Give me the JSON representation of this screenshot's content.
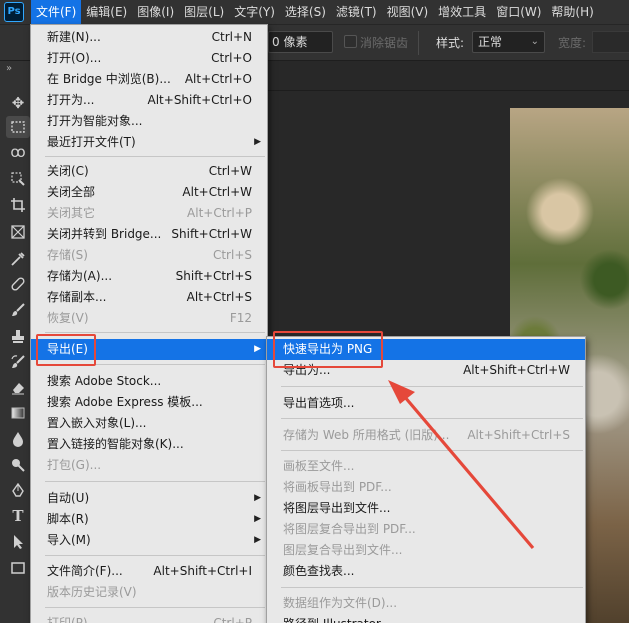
{
  "menubar": {
    "logo": "Ps",
    "items": [
      "文件(F)",
      "编辑(E)",
      "图像(I)",
      "图层(L)",
      "文字(Y)",
      "选择(S)",
      "滤镜(T)",
      "视图(V)",
      "增效工具",
      "窗口(W)",
      "帮助(H)"
    ]
  },
  "options": {
    "feather_value": "0 像素",
    "antialias_label": "消除锯齿",
    "style_label": "样式:",
    "style_value": "正常",
    "width_label": "宽度:"
  },
  "toolbar": {
    "collapse": "»",
    "tools": [
      "move-tool",
      "marquee-tool",
      "lasso-tool",
      "quick-select-tool",
      "crop-tool",
      "frame-tool",
      "eyedropper-tool",
      "healing-tool",
      "brush-tool",
      "stamp-tool",
      "history-brush-tool",
      "eraser-tool",
      "gradient-tool",
      "blur-tool",
      "dodge-tool",
      "pen-tool",
      "text-tool",
      "path-select-tool",
      "rectangle-tool"
    ]
  },
  "file_menu": {
    "items": [
      {
        "label": "新建(N)...",
        "shortcut": "Ctrl+N"
      },
      {
        "label": "打开(O)...",
        "shortcut": "Ctrl+O"
      },
      {
        "label": "在 Bridge 中浏览(B)...",
        "shortcut": "Alt+Ctrl+O"
      },
      {
        "label": "打开为...",
        "shortcut": "Alt+Shift+Ctrl+O"
      },
      {
        "label": "打开为智能对象...",
        "shortcut": ""
      },
      {
        "label": "最近打开文件(T)",
        "shortcut": "",
        "submenu": true
      },
      {
        "label": "关闭(C)",
        "shortcut": "Ctrl+W"
      },
      {
        "label": "关闭全部",
        "shortcut": "Alt+Ctrl+W"
      },
      {
        "label": "关闭其它",
        "shortcut": "Alt+Ctrl+P",
        "disabled": true
      },
      {
        "label": "关闭并转到 Bridge...",
        "shortcut": "Shift+Ctrl+W"
      },
      {
        "label": "存储(S)",
        "shortcut": "Ctrl+S",
        "disabled": true
      },
      {
        "label": "存储为(A)...",
        "shortcut": "Shift+Ctrl+S"
      },
      {
        "label": "存储副本...",
        "shortcut": "Alt+Ctrl+S"
      },
      {
        "label": "恢复(V)",
        "shortcut": "F12",
        "disabled": true
      },
      {
        "label": "导出(E)",
        "shortcut": "",
        "submenu": true,
        "highlighted": true
      },
      {
        "label": "搜索 Adobe Stock...",
        "shortcut": ""
      },
      {
        "label": "搜索 Adobe Express 模板...",
        "shortcut": ""
      },
      {
        "label": "置入嵌入对象(L)...",
        "shortcut": ""
      },
      {
        "label": "置入链接的智能对象(K)...",
        "shortcut": ""
      },
      {
        "label": "打包(G)...",
        "shortcut": "",
        "disabled": true
      },
      {
        "label": "自动(U)",
        "shortcut": "",
        "submenu": true
      },
      {
        "label": "脚本(R)",
        "shortcut": "",
        "submenu": true
      },
      {
        "label": "导入(M)",
        "shortcut": "",
        "submenu": true
      },
      {
        "label": "文件简介(F)...",
        "shortcut": "Alt+Shift+Ctrl+I"
      },
      {
        "label": "版本历史记录(V)",
        "shortcut": "",
        "disabled": true
      },
      {
        "label": "打印(P)...",
        "shortcut": "Ctrl+P",
        "disabled": true
      }
    ]
  },
  "export_menu": {
    "items": [
      {
        "label": "快速导出为 PNG",
        "shortcut": "",
        "highlighted": true
      },
      {
        "label": "导出为...",
        "shortcut": "Alt+Shift+Ctrl+W"
      },
      {
        "label": "导出首选项...",
        "shortcut": ""
      },
      {
        "label": "存储为 Web 所用格式 (旧版)...",
        "shortcut": "Alt+Shift+Ctrl+S",
        "disabled": true
      },
      {
        "label": "画板至文件...",
        "shortcut": "",
        "disabled": true
      },
      {
        "label": "将画板导出到 PDF...",
        "shortcut": "",
        "disabled": true
      },
      {
        "label": "将图层导出到文件...",
        "shortcut": ""
      },
      {
        "label": "将图层复合导出到 PDF...",
        "shortcut": "",
        "disabled": true
      },
      {
        "label": "图层复合导出到文件...",
        "shortcut": "",
        "disabled": true
      },
      {
        "label": "颜色查找表...",
        "shortcut": ""
      },
      {
        "label": "数据组作为文件(D)...",
        "shortcut": "",
        "disabled": true
      },
      {
        "label": "路径到 Illustrator...",
        "shortcut": ""
      }
    ]
  },
  "colors": {
    "accent": "#1473e6",
    "annotation": "#e5483a"
  }
}
